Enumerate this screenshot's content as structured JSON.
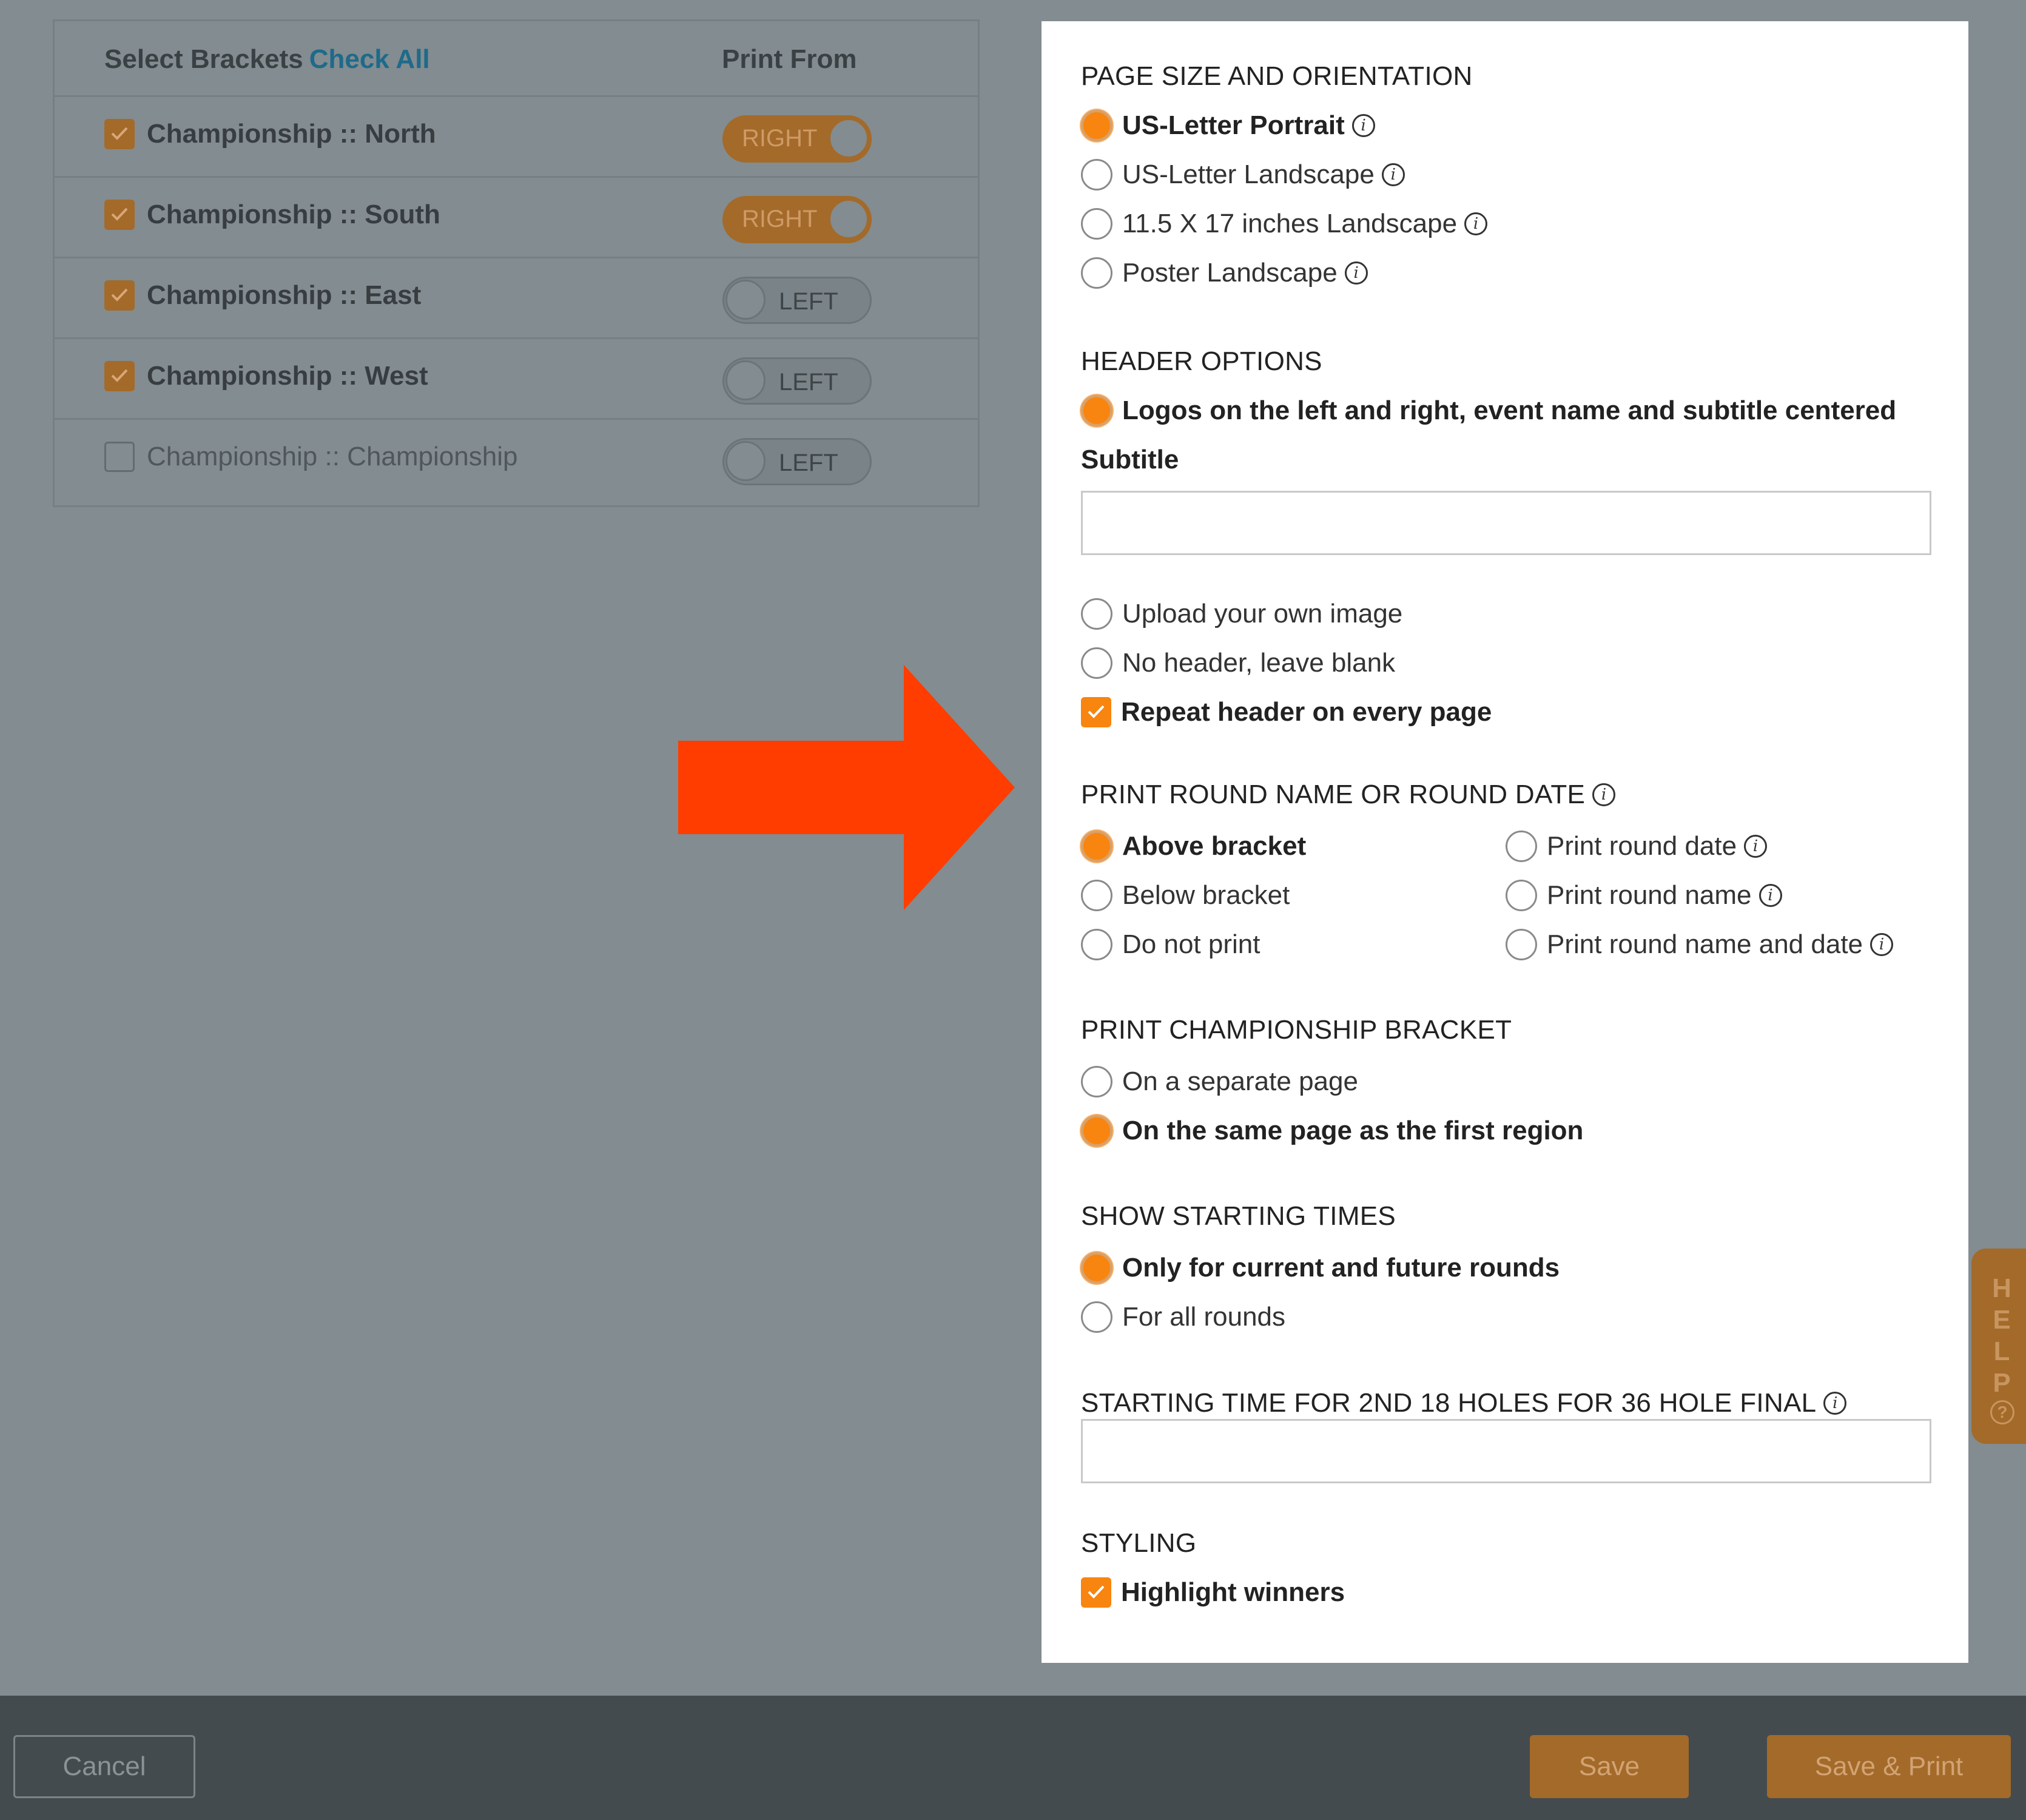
{
  "brackets_table": {
    "header_select": "Select Brackets",
    "header_check_all": "Check All",
    "header_print_from": "Print From",
    "rows": [
      {
        "label": "Championship :: North",
        "checked": true,
        "print_from": "RIGHT"
      },
      {
        "label": "Championship :: South",
        "checked": true,
        "print_from": "RIGHT"
      },
      {
        "label": "Championship :: East",
        "checked": true,
        "print_from": "LEFT"
      },
      {
        "label": "Championship :: West",
        "checked": true,
        "print_from": "LEFT"
      },
      {
        "label": "Championship :: Championship",
        "checked": false,
        "print_from": "LEFT"
      }
    ]
  },
  "panel": {
    "page_size": {
      "title": "PAGE SIZE AND ORIENTATION",
      "options": [
        "US-Letter Portrait",
        "US-Letter Landscape",
        "11.5 X 17 inches Landscape",
        "Poster Landscape"
      ],
      "selected": "US-Letter Portrait"
    },
    "header_options": {
      "title": "HEADER OPTIONS",
      "logos_option": "Logos on the left and right, event name and subtitle centered",
      "subtitle_label": "Subtitle",
      "subtitle_value": "",
      "upload_option": "Upload your own image",
      "no_header_option": "No header, leave blank",
      "repeat_header": "Repeat header on every page",
      "repeat_header_checked": true
    },
    "round_name": {
      "title": "PRINT ROUND NAME OR ROUND DATE",
      "position_options": [
        "Above bracket",
        "Below bracket",
        "Do not print"
      ],
      "position_selected": "Above bracket",
      "content_options": [
        "Print round date",
        "Print round name",
        "Print round name and date"
      ]
    },
    "championship_bracket": {
      "title": "PRINT CHAMPIONSHIP BRACKET",
      "options": [
        "On a separate page",
        "On the same page as the first region"
      ],
      "selected": "On the same page as the first region"
    },
    "starting_times": {
      "title": "SHOW STARTING TIMES",
      "options": [
        "Only for current and future rounds",
        "For all rounds"
      ],
      "selected": "Only for current and future rounds"
    },
    "second_18": {
      "title": "STARTING TIME FOR 2ND 18 HOLES FOR 36 HOLE FINAL",
      "value": ""
    },
    "styling": {
      "title": "STYLING",
      "highlight_winners": "Highlight winners",
      "highlight_checked": true
    }
  },
  "help_tab": {
    "letters": [
      "H",
      "E",
      "L",
      "P"
    ],
    "icon": "question-circle-icon"
  },
  "footer": {
    "cancel": "Cancel",
    "save": "Save",
    "save_print": "Save & Print"
  },
  "colors": {
    "overlay": "#838c90",
    "accent_orange": "#f7850f",
    "dimmed_orange": "#a36a2a",
    "arrow": "#ff3d00",
    "footer": "#434b4f",
    "check_all_link": "#1e6a8a"
  }
}
